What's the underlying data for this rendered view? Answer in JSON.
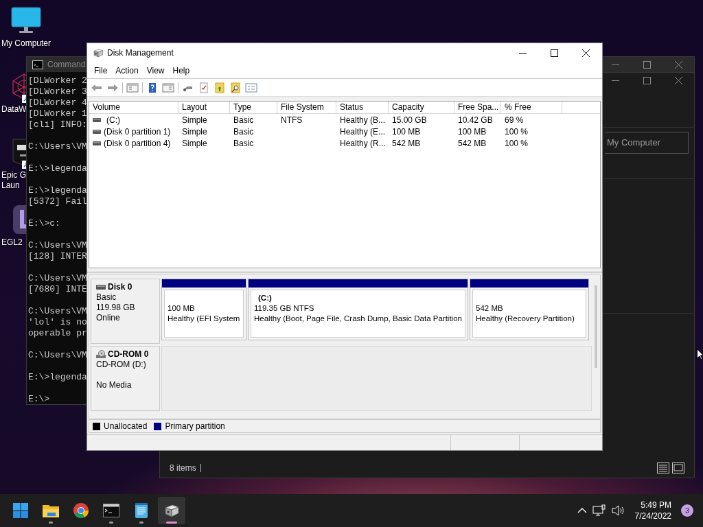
{
  "desktop": {
    "icons": [
      {
        "kind": "computer",
        "lines": [
          "My Computer"
        ]
      },
      {
        "kind": "mesh",
        "shortcut": true,
        "lines": [
          "DataW"
        ]
      },
      {
        "kind": "epic",
        "shortcut": true,
        "lines": [
          "Epic G",
          "Laun"
        ]
      },
      {
        "kind": "tile",
        "shortcut": false,
        "lines": [
          "EGL2"
        ]
      }
    ]
  },
  "command_window": {
    "title": "Command",
    "blocks": [
      [
        "[DLWorker 2",
        "[DLWorker 3",
        "[DLWorker 4",
        "[DLWorker 1",
        "[cli] INFO:"
      ],
      [
        "C:\\Users\\VM"
      ],
      [
        "E:\\>legenda"
      ],
      [
        "E:\\>legenda",
        "[5372] Fail"
      ],
      [
        "E:\\>c:"
      ],
      [
        "C:\\Users\\VM",
        "[128] INTER"
      ],
      [
        "C:\\Users\\VM",
        "[7680] INTE"
      ],
      [
        "C:\\Users\\VM",
        "'lol' is no",
        "operable pr"
      ],
      [
        "C:\\Users\\VM"
      ],
      [
        "E:\\>legenda"
      ],
      [
        "E:\\>"
      ]
    ]
  },
  "explorer_window": {
    "address": "My Computer",
    "status": "8 items"
  },
  "disk_management": {
    "title": "Disk Management",
    "menu": [
      "File",
      "Action",
      "View",
      "Help"
    ],
    "table": {
      "columns": [
        "Volume",
        "Layout",
        "Type",
        "File System",
        "Status",
        "Capacity",
        "Free Spa...",
        "% Free"
      ],
      "rows": [
        {
          "volume": "(C:)",
          "layout": "Simple",
          "type": "Basic",
          "file_system": "NTFS",
          "status": "Healthy (B...",
          "capacity": "15.00 GB",
          "free_space": "10.42 GB",
          "percent_free": "69 %"
        },
        {
          "volume": "(Disk 0 partition 1)",
          "layout": "Simple",
          "type": "Basic",
          "status": "Healthy (E...",
          "capacity": "100 MB",
          "free_space": "100 MB",
          "percent_free": "100 %"
        },
        {
          "volume": "(Disk 0 partition 4)",
          "layout": "Simple",
          "type": "Basic",
          "status": "Healthy (R...",
          "capacity": "542 MB",
          "free_space": "542 MB",
          "percent_free": "100 %"
        }
      ]
    },
    "disks": [
      {
        "kind": "disk",
        "name": "Disk 0",
        "type": "Basic",
        "size": "119.98 GB",
        "status": "Online",
        "partitions": [
          {
            "lines": [
              "100 MB",
              "Healthy (EFI System"
            ]
          },
          {
            "title": "(C:)",
            "lines": [
              "119.35 GB NTFS",
              "Healthy (Boot, Page File, Crash Dump, Basic Data Partition"
            ]
          },
          {
            "lines": [
              "542 MB",
              "Healthy (Recovery Partition)"
            ]
          }
        ]
      },
      {
        "kind": "cdrom",
        "name": "CD-ROM 0",
        "type": "CD-ROM (D:)",
        "status": "No Media"
      }
    ],
    "legend": [
      {
        "label": "Unallocated",
        "color": "#000000"
      },
      {
        "label": "Primary partition",
        "color": "#000080"
      }
    ]
  },
  "taskbar": {
    "apps": [
      {
        "kind": "start",
        "running": false,
        "selected": false
      },
      {
        "kind": "explorer",
        "running": true,
        "selected": false
      },
      {
        "kind": "chrome",
        "running": false,
        "selected": false
      },
      {
        "kind": "terminal",
        "running": true,
        "selected": false
      },
      {
        "kind": "notepad",
        "running": true,
        "selected": false
      },
      {
        "kind": "diskmgmt",
        "running": true,
        "selected": true
      }
    ],
    "time": "5:49 PM",
    "date": "7/24/2022",
    "notifications": "3"
  }
}
